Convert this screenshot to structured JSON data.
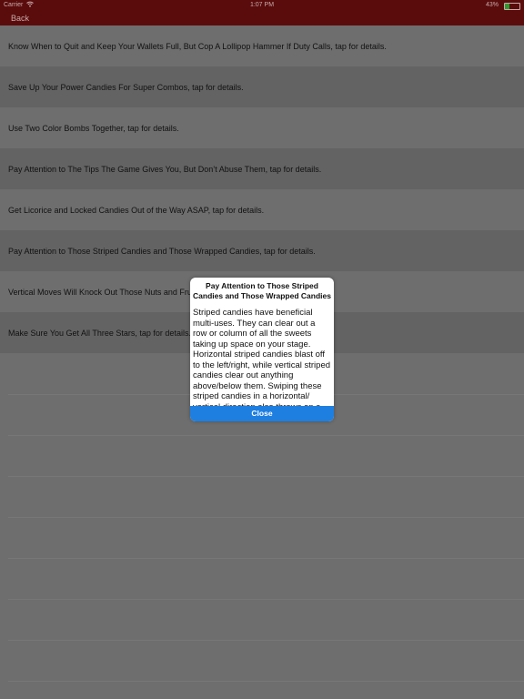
{
  "status_bar": {
    "carrier": "Carrier",
    "wifi_icon": "wifi-icon",
    "time": "1:07 PM",
    "battery_percent": "43%",
    "battery_icon": "battery-icon",
    "battery_level_percent": 30,
    "colors": {
      "bar": "#5a0c0c",
      "battery_fill": "#2f9a2f"
    }
  },
  "nav": {
    "back_label": "Back"
  },
  "tips": [
    "Know When to Quit and Keep Your Wallets Full, But Cop A Lollipop Hammer If Duty Calls, tap for details.",
    "Save Up Your Power Candies For Super Combos, tap for details.",
    "Use Two Color Bombs Together, tap for details.",
    "Pay Attention to The Tips The Game Gives You, But Don’t Abuse Them, tap for details.",
    "Get Licorice and Locked Candies Out of the Way ASAP, tap for details.",
    "Pay Attention to Those Striped Candies and Those Wrapped Candies, tap for details.",
    "Vertical Moves Will Knock Out Those Nuts and Fru",
    "Make Sure You Get All Three Stars, tap for details."
  ],
  "modal": {
    "title": "Pay Attention to Those Striped Candies and Those Wrapped Candies",
    "body": "Striped candies have beneficial multi-uses. They can clear out a row or column of all the sweets taking up space on your stage. Horizontal striped candies blast off to the left/right, while vertical striped candies clear out anything above/below them. Swiping these striped candies in a horizontal/ vertical direction also throws on a",
    "close_label": "Close",
    "colors": {
      "close_button": "#1e7fe0"
    }
  }
}
